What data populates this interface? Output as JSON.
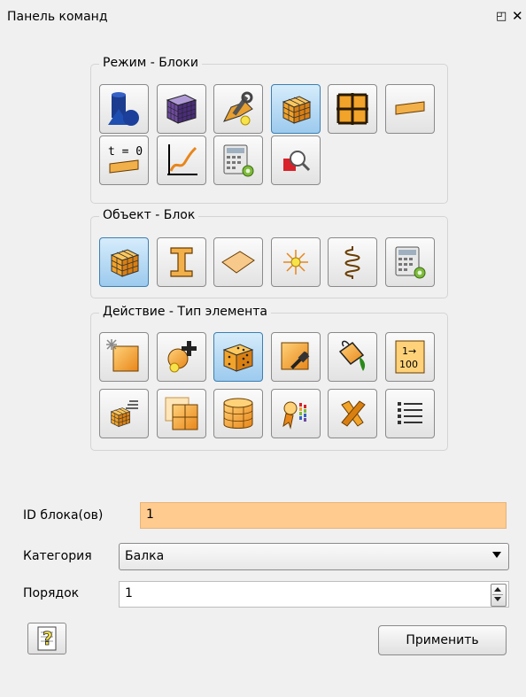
{
  "panel": {
    "title": "Панель команд",
    "float_icon": "float-window-icon",
    "close_glyph": "✕"
  },
  "groups": {
    "mode": {
      "title": "Режим - Блоки"
    },
    "object": {
      "title": "Объект - Блок"
    },
    "action": {
      "title": "Действие - Тип элемента"
    }
  },
  "mode_buttons": [
    {
      "icon": "geometry-shapes-icon",
      "active": false
    },
    {
      "icon": "mesh-cube-icon",
      "active": false
    },
    {
      "icon": "wrench-tools-icon",
      "active": false
    },
    {
      "icon": "blocks-cube-icon",
      "active": true
    },
    {
      "icon": "grid-frame-icon",
      "active": false
    },
    {
      "icon": "beam-section-icon",
      "active": false
    },
    {
      "icon": "initial-conditions-icon",
      "label": "t = 0",
      "active": false
    },
    {
      "icon": "curve-graph-icon",
      "active": false
    },
    {
      "icon": "calculator-settings-icon",
      "active": false
    },
    {
      "icon": "search-magnifier-icon",
      "active": false
    }
  ],
  "object_buttons": [
    {
      "icon": "block-cube-icon",
      "active": true
    },
    {
      "icon": "i-beam-icon",
      "active": false
    },
    {
      "icon": "shell-surface-icon",
      "active": false
    },
    {
      "icon": "node-star-icon",
      "active": false
    },
    {
      "icon": "spring-icon",
      "active": false
    },
    {
      "icon": "calculator-settings-icon",
      "active": false
    }
  ],
  "action_buttons": [
    {
      "icon": "create-block-icon",
      "active": false
    },
    {
      "icon": "add-node-icon",
      "active": false
    },
    {
      "icon": "element-type-cube-icon",
      "active": true
    },
    {
      "icon": "hammer-block-icon",
      "active": false
    },
    {
      "icon": "paint-bucket-icon",
      "active": false
    },
    {
      "icon": "renumber-icon",
      "label_top": "1→",
      "label_bottom": "100",
      "active": false
    },
    {
      "icon": "list-blocks-icon",
      "active": false
    },
    {
      "icon": "split-block-icon",
      "active": false
    },
    {
      "icon": "cylinder-icon",
      "active": false
    },
    {
      "icon": "quality-ribbon-icon",
      "active": false
    },
    {
      "icon": "delete-x-icon",
      "active": false
    },
    {
      "icon": "list-view-icon",
      "active": false
    }
  ],
  "form": {
    "id_label": "ID блока(ов)",
    "id_value": "1",
    "category_label": "Категория",
    "category_value": "Балка",
    "order_label": "Порядок",
    "order_value": "1"
  },
  "buttons": {
    "help_icon": "help-question-icon",
    "apply_label": "Применить"
  },
  "colors": {
    "accent_input": "#ffcb8e",
    "active_button": "#9ccaee",
    "block_orange": "#f5a623"
  }
}
